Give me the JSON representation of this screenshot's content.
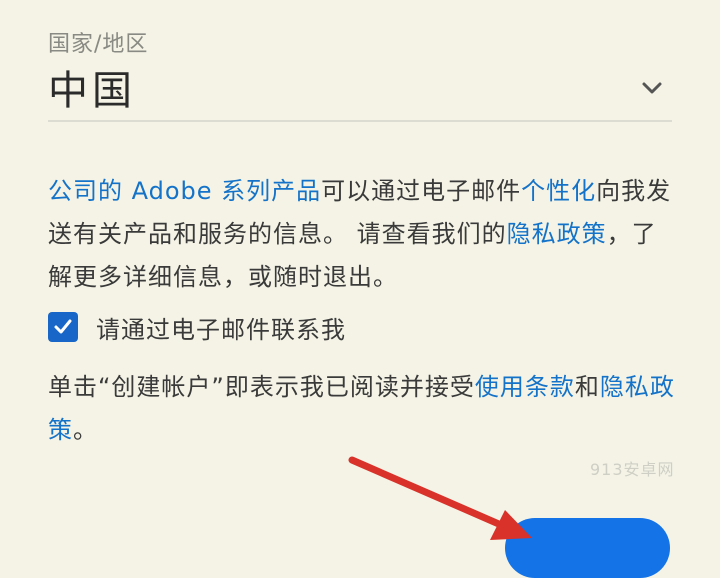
{
  "country": {
    "label": "国家/地区",
    "value": "中国"
  },
  "consent": {
    "link_company_products": "公司的 Adobe 系列产品",
    "text_1": "可以通过电子邮件",
    "link_personalize": "个性化",
    "text_2": "向我发送有关产品和服务的信息。 请查看我们的",
    "link_privacy": "隐私政策",
    "text_3": "，了解更多详细信息，或随时退出。"
  },
  "checkbox": {
    "label": "请通过电子邮件联系我",
    "checked": true
  },
  "terms": {
    "text_1": "单击“创建帐户”即表示我已阅读并接受",
    "link_terms": "使用条款",
    "text_2": "和",
    "link_privacy": "隐私政策",
    "text_3": "。"
  },
  "watermark": "913安卓网",
  "colors": {
    "background": "#f4f3e6",
    "link": "#1473c9",
    "checkbox": "#1766c8",
    "button": "#1473e6",
    "arrow": "#d8322b"
  }
}
